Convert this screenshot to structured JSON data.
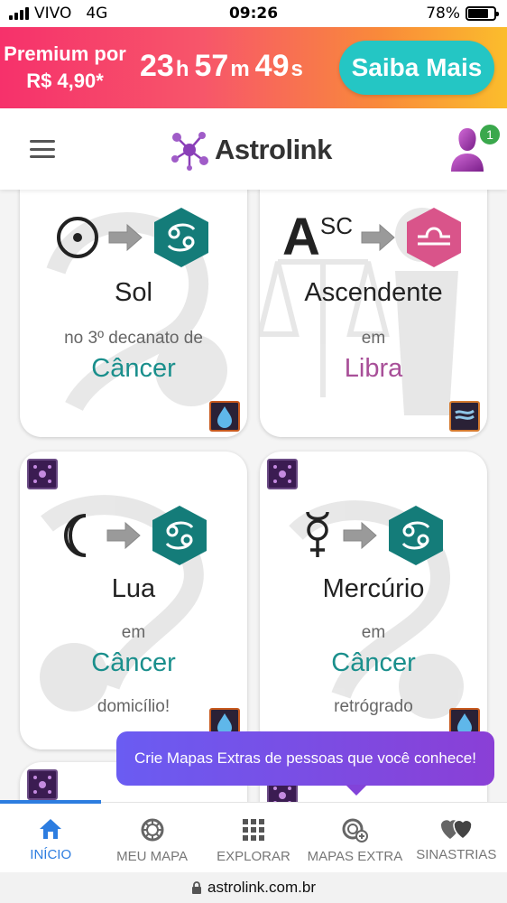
{
  "status_bar": {
    "carrier": "VIVO",
    "network": "4G",
    "time": "09:26",
    "battery": "78%"
  },
  "promo": {
    "line1": "Premium por",
    "line2": "R$ 4,90*",
    "countdown": {
      "hours": "23",
      "h": "h",
      "minutes": "57",
      "m": "m",
      "seconds": "49",
      "s": "s"
    },
    "cta_label": "Saiba Mais"
  },
  "header": {
    "logo_text": "Astrolink",
    "notification_count": "1"
  },
  "cards": [
    {
      "title": "Sol",
      "sub": "no 3º decanato de",
      "sign": "Câncer",
      "extra": "",
      "sign_color": "#1a8f8c"
    },
    {
      "title": "Ascendente",
      "sub": "em",
      "sign": "Libra",
      "extra": "",
      "asc_A": "A",
      "asc_SC": "SC",
      "sign_color": "#a84f98"
    },
    {
      "title": "Lua",
      "sub": "em",
      "sign": "Câncer",
      "extra": "domicílio!",
      "sign_color": "#1a8f8c"
    },
    {
      "title": "Mercúrio",
      "sub": "em",
      "sign": "Câncer",
      "extra": "retrógrado",
      "sign_color": "#1a8f8c"
    }
  ],
  "tooltip": {
    "text": "Crie Mapas Extras de pessoas que você conhece!"
  },
  "tabs": [
    {
      "label": "INÍCIO",
      "icon": "home-icon",
      "active": true
    },
    {
      "label": "MEU MAPA",
      "icon": "chart-wheel-icon",
      "active": false
    },
    {
      "label": "EXPLORAR",
      "icon": "grid-icon",
      "active": false
    },
    {
      "label": "MAPAS EXTRA",
      "icon": "add-chart-icon",
      "active": false
    },
    {
      "label": "SINASTRIAS",
      "icon": "hearts-icon",
      "active": false
    }
  ],
  "url_bar": {
    "url": "astrolink.com.br"
  },
  "colors": {
    "teal": "#1a8f8c",
    "pink": "#d9548a",
    "accent_blue": "#2d7de0"
  }
}
